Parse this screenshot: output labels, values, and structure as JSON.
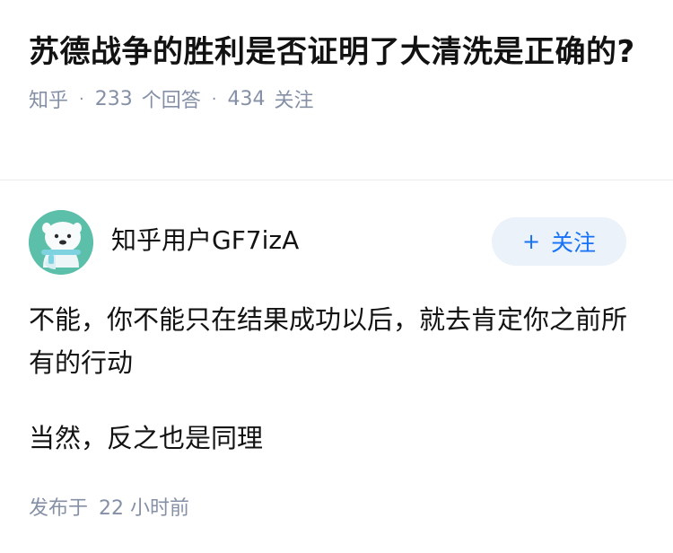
{
  "question": {
    "title": "苏德战争的胜利是否证明了大清洗是正确的?",
    "source": "知乎",
    "answer_count": "233",
    "answer_label": "个回答",
    "follower_count": "434",
    "follower_label": "关注"
  },
  "author": {
    "name": "知乎用户GF7izA",
    "avatar_icon": "cartoon-avatar-icon",
    "follow_label": "关注",
    "follow_icon": "plus-icon"
  },
  "answer": {
    "paragraphs": [
      "不能，你不能只在结果成功以后，就去肯定你之前所有的行动",
      "当然，反之也是同理"
    ],
    "published_label": "发布于",
    "published_time": "22 小时前"
  },
  "colors": {
    "accent": "#1772f6",
    "follow_bg": "#ebf2fa",
    "meta_text": "#8590a6",
    "avatar_bg": "#5cbfa9"
  }
}
